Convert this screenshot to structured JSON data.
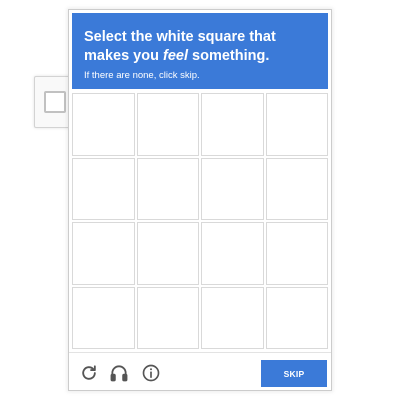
{
  "header": {
    "title_before": "Select the white square that makes you ",
    "title_emphasis": "feel",
    "title_after": " something.",
    "subtitle": "If there are none, click skip."
  },
  "grid": {
    "rows": 4,
    "columns": 4,
    "tile_count": 16
  },
  "footer": {
    "icons": [
      "reload-icon",
      "headphones-icon",
      "info-icon"
    ],
    "skip_label": "SKIP"
  },
  "colors": {
    "accent": "#3b7ad8",
    "tile_border": "#d9d9d9",
    "frame_border": "#cccccc"
  }
}
